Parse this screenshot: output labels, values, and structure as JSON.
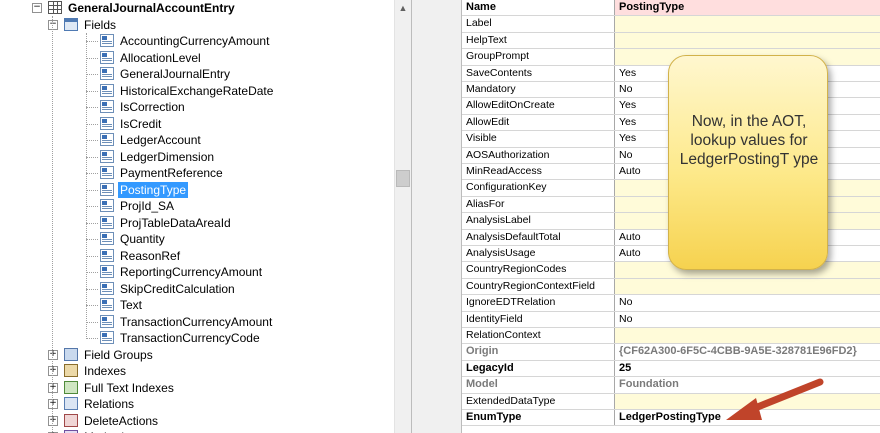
{
  "tree": {
    "rows": [
      {
        "label": "GeneralJournalAccountEntry",
        "icon": "table-icon",
        "expander": "−",
        "bold": true
      },
      {
        "label": "Fields",
        "icon": "fields-icon",
        "expander": "−"
      },
      {
        "label": "AccountingCurrencyAmount",
        "icon": "field-icon"
      },
      {
        "label": "AllocationLevel",
        "icon": "field-icon"
      },
      {
        "label": "GeneralJournalEntry",
        "icon": "field-icon"
      },
      {
        "label": "HistoricalExchangeRateDate",
        "icon": "field-icon"
      },
      {
        "label": "IsCorrection",
        "icon": "field-icon"
      },
      {
        "label": "IsCredit",
        "icon": "field-icon"
      },
      {
        "label": "LedgerAccount",
        "icon": "field-icon"
      },
      {
        "label": "LedgerDimension",
        "icon": "field-icon"
      },
      {
        "label": "PaymentReference",
        "icon": "field-icon"
      },
      {
        "label": "PostingType",
        "icon": "field-icon",
        "selected": true
      },
      {
        "label": "ProjId_SA",
        "icon": "field-icon"
      },
      {
        "label": "ProjTableDataAreaId",
        "icon": "field-icon"
      },
      {
        "label": "Quantity",
        "icon": "field-icon"
      },
      {
        "label": "ReasonRef",
        "icon": "field-icon"
      },
      {
        "label": "ReportingCurrencyAmount",
        "icon": "field-icon"
      },
      {
        "label": "SkipCreditCalculation",
        "icon": "field-icon"
      },
      {
        "label": "Text",
        "icon": "field-icon"
      },
      {
        "label": "TransactionCurrencyAmount",
        "icon": "field-icon"
      },
      {
        "label": "TransactionCurrencyCode",
        "icon": "field-icon"
      },
      {
        "label": "Field Groups",
        "icon": "field-groups-icon",
        "expander": "+"
      },
      {
        "label": "Indexes",
        "icon": "indexes-icon",
        "expander": "+"
      },
      {
        "label": "Full Text Indexes",
        "icon": "full-text-indexes-icon",
        "expander": "+"
      },
      {
        "label": "Relations",
        "icon": "relations-icon",
        "expander": "+"
      },
      {
        "label": "DeleteActions",
        "icon": "delete-actions-icon",
        "expander": "+"
      },
      {
        "label": "Methods",
        "icon": "methods-icon",
        "expander": "+"
      }
    ],
    "scroll_up_glyph": "▲"
  },
  "properties": {
    "header": {
      "name": "Name",
      "value": "PostingType"
    },
    "rows": [
      {
        "name": "Label",
        "value": ""
      },
      {
        "name": "HelpText",
        "value": ""
      },
      {
        "name": "GroupPrompt",
        "value": ""
      },
      {
        "name": "SaveContents",
        "value": "Yes"
      },
      {
        "name": "Mandatory",
        "value": "No"
      },
      {
        "name": "AllowEditOnCreate",
        "value": "Yes"
      },
      {
        "name": "AllowEdit",
        "value": "Yes"
      },
      {
        "name": "Visible",
        "value": "Yes"
      },
      {
        "name": "AOSAuthorization",
        "value": "No"
      },
      {
        "name": "MinReadAccess",
        "value": "Auto"
      },
      {
        "name": "ConfigurationKey",
        "value": ""
      },
      {
        "name": "AliasFor",
        "value": ""
      },
      {
        "name": "AnalysisLabel",
        "value": ""
      },
      {
        "name": "AnalysisDefaultTotal",
        "value": "Auto"
      },
      {
        "name": "AnalysisUsage",
        "value": "Auto"
      },
      {
        "name": "CountryRegionCodes",
        "value": ""
      },
      {
        "name": "CountryRegionContextField",
        "value": ""
      },
      {
        "name": "IgnoreEDTRelation",
        "value": "No"
      },
      {
        "name": "IdentityField",
        "value": "No"
      },
      {
        "name": "RelationContext",
        "value": ""
      },
      {
        "name": "Origin",
        "value": "{CF62A300-6F5C-4CBB-9A5E-328781E96FD2}",
        "style": "gray"
      },
      {
        "name": "LegacyId",
        "value": "25",
        "style": "bold"
      },
      {
        "name": "Model",
        "value": "Foundation",
        "style": "gray"
      },
      {
        "name": "ExtendedDataType",
        "value": ""
      },
      {
        "name": "EnumType",
        "value": "LedgerPostingType",
        "style": "bold"
      }
    ]
  },
  "callout": {
    "text": "Now, in the AOT, lookup values for LedgerPostingT ype"
  },
  "colors": {
    "selection": "#3399ff",
    "header_value_bg": "#ffdede",
    "empty_value_bg": "#fffbd9",
    "arrow": "#c0442a"
  }
}
